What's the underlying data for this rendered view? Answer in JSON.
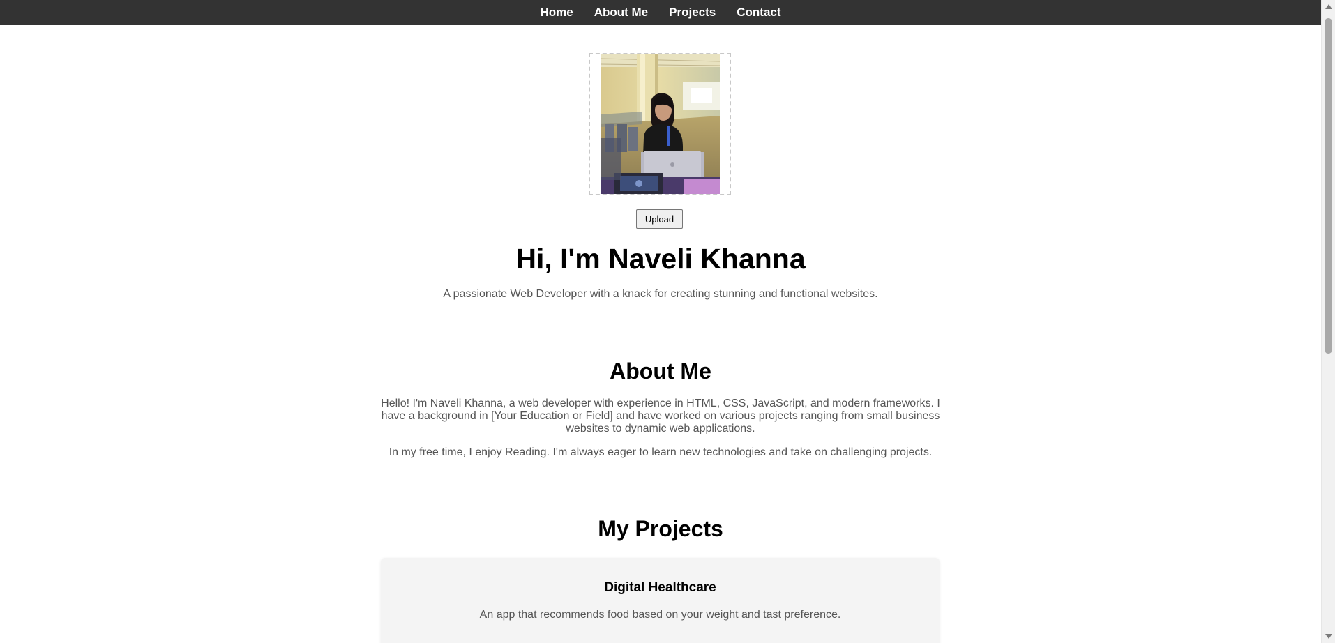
{
  "nav": {
    "items": [
      {
        "label": "Home"
      },
      {
        "label": "About Me"
      },
      {
        "label": "Projects"
      },
      {
        "label": "Contact"
      }
    ]
  },
  "hero": {
    "photo_alt": "Profile photo",
    "upload_label": "Upload",
    "title": "Hi, I'm Naveli Khanna",
    "subtitle": "A passionate Web Developer with a knack for creating stunning and functional websites."
  },
  "about": {
    "title": "About Me",
    "paragraph_1": "Hello! I'm Naveli Khanna, a web developer with experience in HTML, CSS, JavaScript, and modern frameworks. I have a background in [Your Education or Field] and have worked on various projects ranging from small business websites to dynamic web applications.",
    "paragraph_2": "In my free time, I enjoy Reading. I'm always eager to learn new technologies and take on challenging projects."
  },
  "projects": {
    "title": "My Projects",
    "items": [
      {
        "name": "Digital Healthcare",
        "description": "An app that recommends food based on your weight and tast preference."
      }
    ]
  },
  "colors": {
    "nav_bg": "#333333",
    "nav_text": "#ffffff",
    "body_text": "#555555",
    "card_bg": "#f4f4f4"
  }
}
